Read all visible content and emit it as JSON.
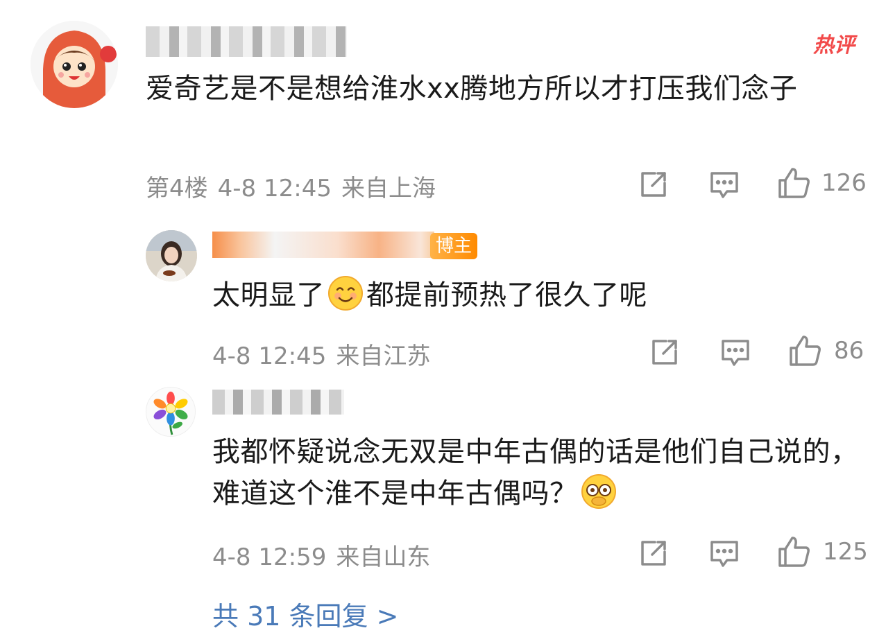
{
  "comment": {
    "hot_tag": "热评",
    "text": "爱奇艺是不是想给淮水xx腾地方所以才打压我们念子",
    "floor": "第4楼",
    "time": "4-8 12:45",
    "location": "来自上海",
    "likes": "126"
  },
  "replies": [
    {
      "badge": "博主",
      "text_before": "太明显了",
      "text_after": "都提前预热了很久了呢",
      "time": "4-8 12:45",
      "location": "来自江苏",
      "likes": "86"
    },
    {
      "text": "我都怀疑说念无双是中年古偶的话是他们自己说的，难道这个淮不是中年古偶吗？",
      "time": "4-8 12:59",
      "location": "来自山东",
      "likes": "125"
    }
  ],
  "more_replies": "共 31 条回复 >",
  "colors": {
    "meta": "#8c8c8c",
    "link": "#4a7ab8",
    "hot": "#f24a4a"
  }
}
